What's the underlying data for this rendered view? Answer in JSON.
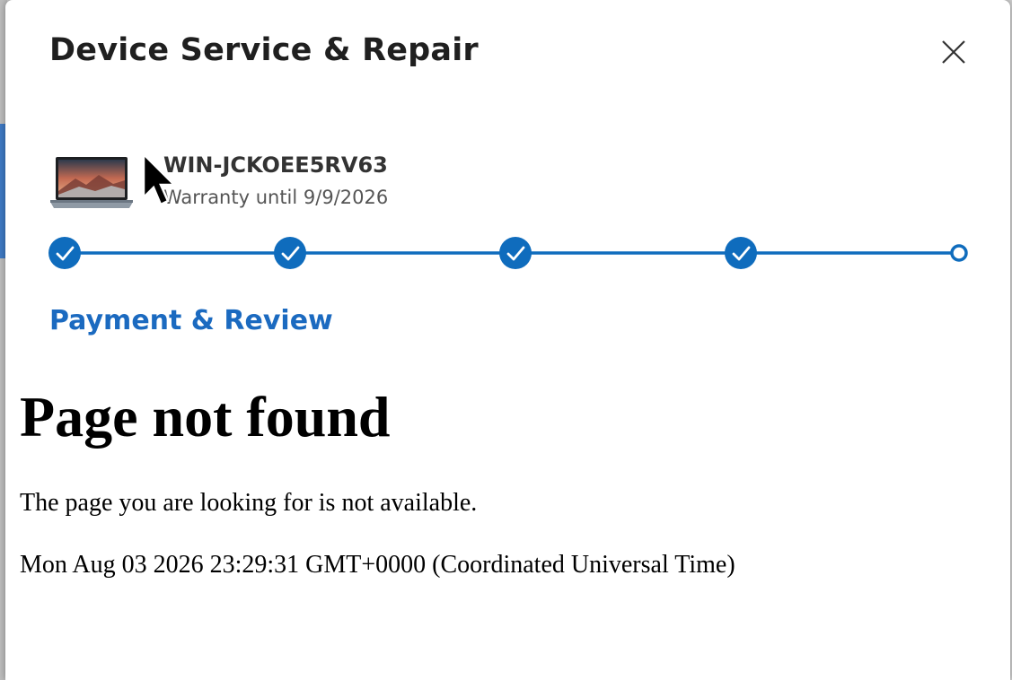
{
  "dialog": {
    "title": "Device Service & Repair"
  },
  "device": {
    "name": "WIN-JCKOEE5RV63",
    "warranty": "Warranty until 9/9/2026",
    "image": "laptop-icon"
  },
  "stepper": {
    "total_steps": 5,
    "completed_steps": 4,
    "accent": "#0f6cbd"
  },
  "step": {
    "heading": "Payment & Review"
  },
  "error": {
    "title": "Page not found",
    "message": "The page you are looking for is not available.",
    "timestamp": "Mon Aug 03 2026 23:29:31 GMT+0000 (Coordinated Universal Time)"
  },
  "icons": {
    "close": "close-icon",
    "step_done": "checkmark-icon",
    "step_current": "circle-outline-icon",
    "cursor": "mouse-pointer-icon"
  }
}
